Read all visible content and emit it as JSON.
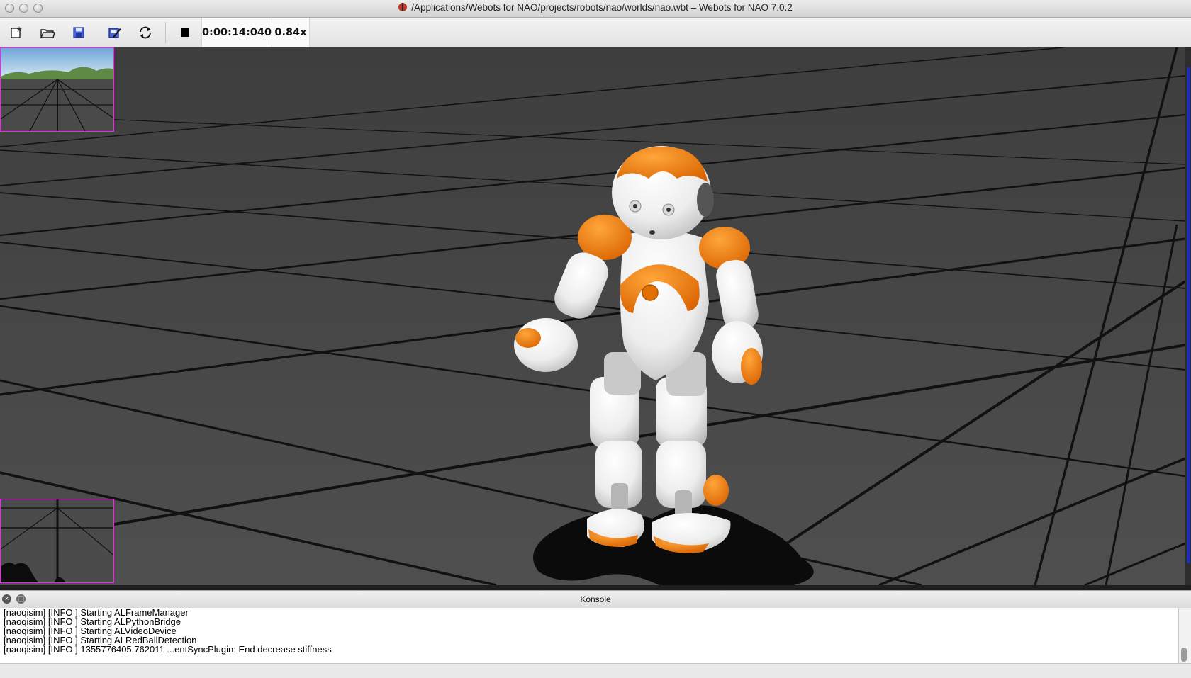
{
  "window": {
    "title": "/Applications/Webots for NAO/projects/robots/nao/worlds/nao.wbt – Webots for NAO 7.0.2",
    "app_icon": "ladybug-icon"
  },
  "toolbar": {
    "buttons": [
      {
        "name": "new-world",
        "icon": "new-file-icon"
      },
      {
        "name": "open-world",
        "icon": "open-folder-icon"
      },
      {
        "name": "save-world",
        "icon": "save-icon"
      },
      {
        "name": "save-as-world",
        "icon": "save-as-icon"
      },
      {
        "name": "revert-world",
        "icon": "reload-icon"
      },
      {
        "name": "stop-simulation",
        "icon": "stop-icon"
      }
    ],
    "simulation_time": "0:00:14:040",
    "speed_factor": "0.84x"
  },
  "viewport": {
    "colors": {
      "floor": "#4a4a4a",
      "grid_line": "#101010",
      "robot_body": "#f4f4f4",
      "robot_accent": "#f07a00",
      "camera_border": "#ff1aff"
    }
  },
  "console": {
    "title": "Konsole",
    "lines": [
      "[naoqisim] [INFO ] Starting ALFrameManager",
      "[naoqisim] [INFO ] Starting ALPythonBridge",
      "[naoqisim] [INFO ] Starting ALVideoDevice",
      "[naoqisim] [INFO ] Starting ALRedBallDetection",
      "[naoqisim] [INFO ] 1355776405.762011 ...entSyncPlugin: End decrease stiffness"
    ]
  }
}
